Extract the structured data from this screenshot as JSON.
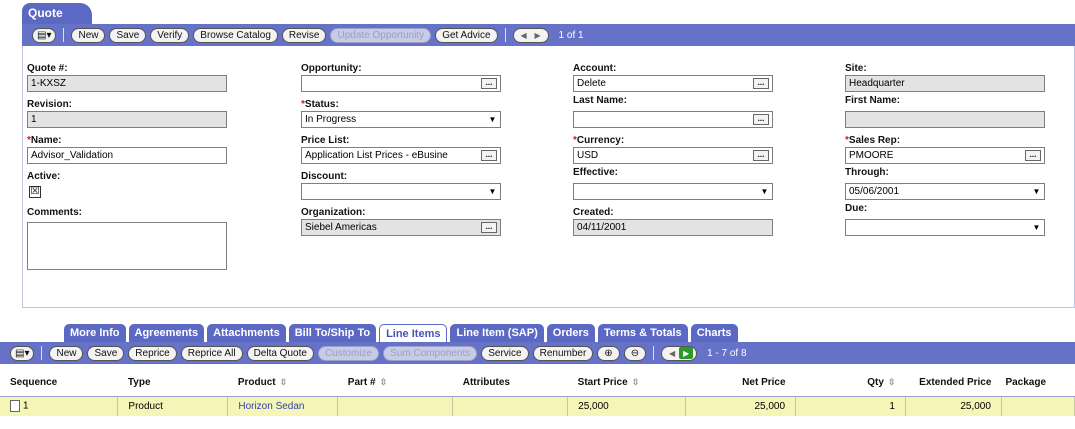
{
  "header": {
    "title": "Quote",
    "buttons": {
      "menu": "▤▾",
      "new": "New",
      "save": "Save",
      "verify": "Verify",
      "browse_catalog": "Browse Catalog",
      "revise": "Revise",
      "update_opportunity": "Update Opportunity",
      "get_advice": "Get Advice"
    },
    "record_count": "1 of 1"
  },
  "form": {
    "quote_num": {
      "label": "Quote #:",
      "value": "1-KXSZ"
    },
    "revision": {
      "label": "Revision:",
      "value": "1"
    },
    "name": {
      "label": "Name:",
      "value": "Advisor_Validation"
    },
    "active": {
      "label": "Active:",
      "checked_glyph": "☒"
    },
    "comments": {
      "label": "Comments:",
      "value": ""
    },
    "opportunity": {
      "label": "Opportunity:",
      "value": ""
    },
    "status": {
      "label": "Status:",
      "value": "In Progress"
    },
    "price_list": {
      "label": "Price List:",
      "value": "Application List Prices - eBusine"
    },
    "discount": {
      "label": "Discount:",
      "value": ""
    },
    "organization": {
      "label": "Organization:",
      "value": "Siebel Americas"
    },
    "account": {
      "label": "Account:",
      "value": "Delete"
    },
    "last_name": {
      "label": "Last Name:",
      "value": ""
    },
    "currency": {
      "label": "Currency:",
      "value": "USD"
    },
    "effective": {
      "label": "Effective:",
      "value": ""
    },
    "created": {
      "label": "Created:",
      "value": "04/11/2001"
    },
    "site": {
      "label": "Site:",
      "value": "Headquarter"
    },
    "first_name": {
      "label": "First Name:",
      "value": ""
    },
    "sales_rep": {
      "label": "Sales Rep:",
      "value": "PMOORE"
    },
    "through": {
      "label": "Through:",
      "value": "05/06/2001"
    },
    "due": {
      "label": "Due:",
      "value": ""
    },
    "required_mark": "*",
    "dots": "...",
    "dropdown": "▼"
  },
  "tabs": [
    {
      "label": "More Info"
    },
    {
      "label": "Agreements"
    },
    {
      "label": "Attachments"
    },
    {
      "label": "Bill To/Ship To"
    },
    {
      "label": "Line Items"
    },
    {
      "label": "Line Item (SAP)"
    },
    {
      "label": "Orders"
    },
    {
      "label": "Terms & Totals"
    },
    {
      "label": "Charts"
    }
  ],
  "list_toolbar": {
    "menu": "▤▾",
    "new": "New",
    "save": "Save",
    "reprice": "Reprice",
    "reprice_all": "Reprice All",
    "delta_quote": "Delta Quote",
    "customize": "Customize",
    "sum_components": "Sum Components",
    "service": "Service",
    "renumber": "Renumber",
    "expand": "⊕",
    "collapse": "⊖",
    "record_count": "1 - 7 of 8"
  },
  "grid": {
    "columns": [
      "Sequence",
      "Type",
      "Product",
      "Part #",
      "Attributes",
      "Start Price",
      "Net Price",
      "Qty",
      "Extended Price",
      "Package"
    ],
    "sort_glyph": "⇳",
    "rows": [
      {
        "sequence": "1",
        "type": "Product",
        "product": "Horizon Sedan",
        "part": "",
        "attributes": "",
        "start_price": "25,000",
        "net_price": "25,000",
        "qty": "1",
        "extended_price": "25,000",
        "package": ""
      }
    ]
  },
  "colors": {
    "header_blue": "#5c69c4",
    "row_yellow": "#f4f5b6",
    "required_red": "#d21818"
  }
}
